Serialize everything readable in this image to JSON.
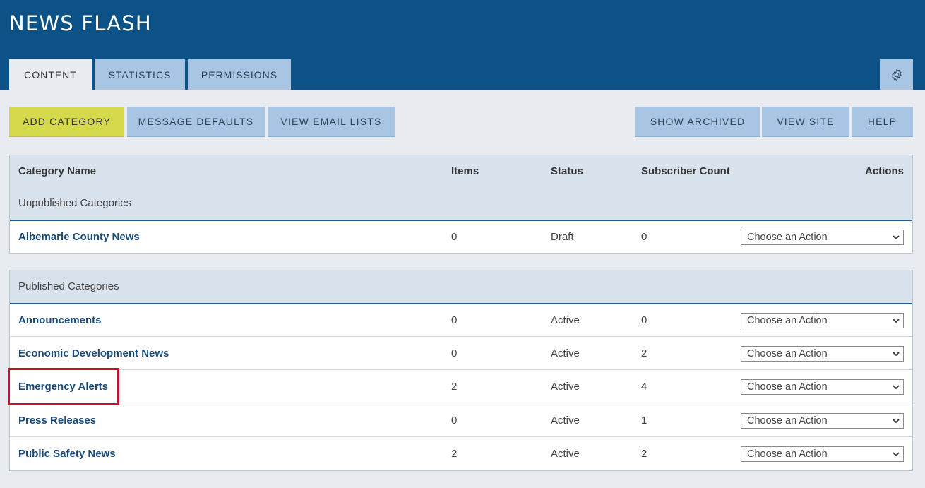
{
  "app": {
    "title": "NEWS FLASH"
  },
  "tabs": [
    {
      "label": "CONTENT",
      "active": true
    },
    {
      "label": "STATISTICS",
      "active": false
    },
    {
      "label": "PERMISSIONS",
      "active": false
    }
  ],
  "settings_icon": "gear-icon",
  "toolbar": {
    "left": [
      "ADD CATEGORY",
      "MESSAGE DEFAULTS",
      "VIEW EMAIL LISTS"
    ],
    "right": [
      "SHOW ARCHIVED",
      "VIEW SITE",
      "HELP"
    ]
  },
  "table": {
    "columns": [
      "Category Name",
      "Items",
      "Status",
      "Subscriber Count",
      "Actions"
    ],
    "unpublished": {
      "label": "Unpublished Categories",
      "rows": [
        {
          "name": "Albemarle County News",
          "items": "0",
          "status": "Draft",
          "subscribers": "0",
          "action": "Choose an Action"
        }
      ]
    },
    "published": {
      "label": "Published Categories",
      "rows": [
        {
          "name": "Announcements",
          "items": "0",
          "status": "Active",
          "subscribers": "0",
          "action": "Choose an Action"
        },
        {
          "name": "Economic Development News",
          "items": "0",
          "status": "Active",
          "subscribers": "2",
          "action": "Choose an Action"
        },
        {
          "name": "Emergency Alerts",
          "items": "2",
          "status": "Active",
          "subscribers": "4",
          "action": "Choose an Action"
        },
        {
          "name": "Press Releases",
          "items": "0",
          "status": "Active",
          "subscribers": "1",
          "action": "Choose an Action"
        },
        {
          "name": "Public Safety News",
          "items": "2",
          "status": "Active",
          "subscribers": "2",
          "action": "Choose an Action"
        }
      ]
    }
  },
  "colors": {
    "header": "#0d5286",
    "tab": "#a8c6e4",
    "primary_button": "#d5d94c",
    "link": "#1a4a78",
    "highlight": "#c0152a"
  }
}
